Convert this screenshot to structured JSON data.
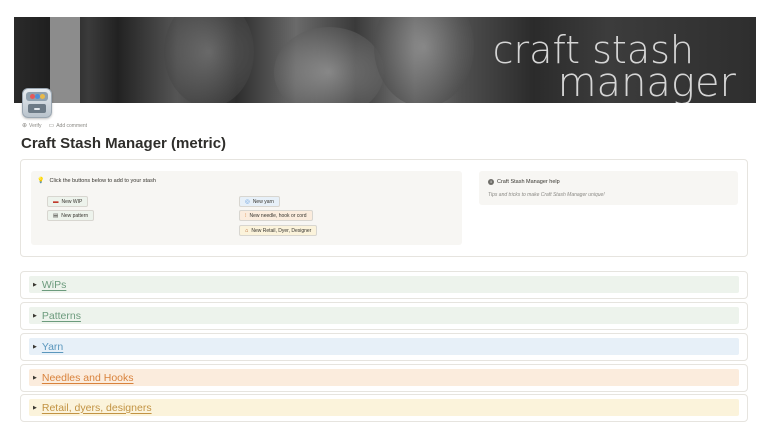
{
  "banner": {
    "line1": "craft stash",
    "line2": "manager"
  },
  "meta": {
    "verify": "Verify",
    "comment": "Add comment"
  },
  "page": {
    "title": "Craft Stash Manager (metric)"
  },
  "add_callout": {
    "heading": "Click the buttons below to add to your stash",
    "buttons": [
      {
        "label": "New WIP",
        "icon": "yarn-icon"
      },
      {
        "label": "New pattern",
        "icon": "pattern-icon"
      },
      {
        "label": "New yarn",
        "icon": "yarn-ball-icon"
      },
      {
        "label": "New needle, hook or cord",
        "icon": "needle-icon"
      },
      {
        "label": "New Retail, Dyer, Designer",
        "icon": "shop-icon"
      }
    ]
  },
  "help_callout": {
    "heading": "Craft Stash Manager help",
    "subtitle": "Tips and tricks to make Craft Stash Manager unique!"
  },
  "sections": [
    {
      "label": "WiPs",
      "bg": "#edf3ec",
      "color": "#6c9b7d"
    },
    {
      "label": "Patterns",
      "bg": "#edf3ec",
      "color": "#6c9b7d"
    },
    {
      "label": "Yarn",
      "bg": "#e7f0f8",
      "color": "#5b97bd"
    },
    {
      "label": "Needles and Hooks",
      "bg": "#fbecdd",
      "color": "#d9823b"
    },
    {
      "label": "Retail, dyers, designers",
      "bg": "#fbf3db",
      "color": "#c29343"
    }
  ]
}
